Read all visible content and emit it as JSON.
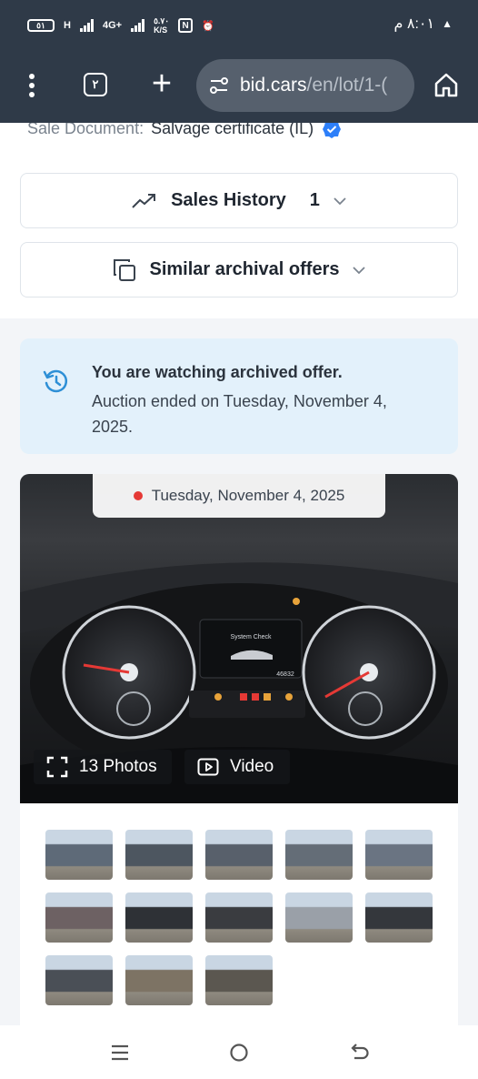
{
  "status_bar": {
    "battery": "٥١",
    "network_1": "H",
    "network_2": "4G+",
    "speed_value": "٥.٧٠",
    "speed_unit": "K/S",
    "time": "٨:٠١ م"
  },
  "browser": {
    "tab_count": "٢",
    "url_domain": "bid.cars",
    "url_path": "/en/lot/1-("
  },
  "details": {
    "sale_document_label": "Sale Document:",
    "sale_document_value": "Salvage certificate (IL)"
  },
  "sales_history": {
    "label": "Sales History",
    "count": "1"
  },
  "similar_offers": {
    "label": "Similar archival offers"
  },
  "notice": {
    "title": "You are watching archived offer.",
    "text": "Auction ended on Tuesday, November 4, 2025."
  },
  "gallery": {
    "date": "Tuesday, November 4, 2025",
    "photos_label": "13 Photos",
    "video_label": "Video",
    "dash_display_title": "System Check",
    "odometer": "46832",
    "thumbnails": [
      {
        "name": "front-left-view",
        "color": "#5e6a78"
      },
      {
        "name": "left-side-view",
        "color": "#4d5660"
      },
      {
        "name": "rear-view",
        "color": "#58606b"
      },
      {
        "name": "side-view",
        "color": "#646d77"
      },
      {
        "name": "front-view",
        "color": "#6a7482"
      },
      {
        "name": "damaged-front",
        "color": "#6d6163"
      },
      {
        "name": "interior-front",
        "color": "#2e3136"
      },
      {
        "name": "interior-console",
        "color": "#3a3c40"
      },
      {
        "name": "instrument-cluster",
        "color": "#9aa0a8"
      },
      {
        "name": "rear-seats",
        "color": "#34373c"
      },
      {
        "name": "engine-bay",
        "color": "#4a4f56"
      },
      {
        "name": "broken-part",
        "color": "#7d7364"
      },
      {
        "name": "vin-label",
        "color": "#5b5750"
      }
    ]
  }
}
